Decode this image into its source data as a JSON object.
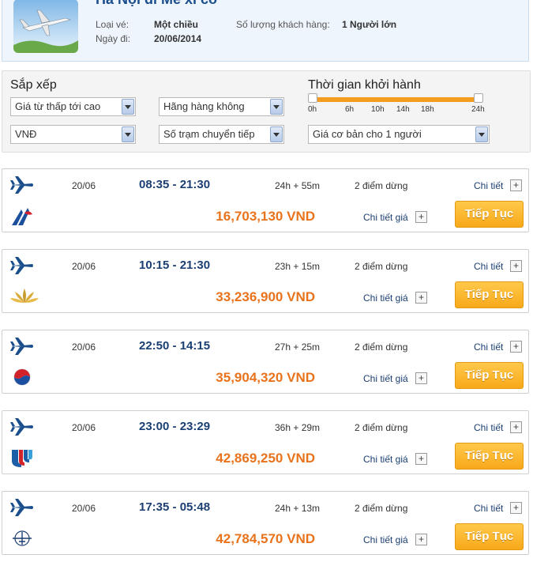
{
  "header": {
    "route_title": "Hà Nội đi Mê xi cô",
    "ticket_type_label": "Loại vé:",
    "ticket_type_value": "Một chiều",
    "passengers_label": "Số lượng khách hàng:",
    "passengers_value": "1 Người lớn",
    "date_label": "Ngày đi:",
    "date_value": "20/06/2014"
  },
  "filters": {
    "sort_title": "Sắp xếp",
    "sort_select": "Giá từ thấp tới cao",
    "airline_select": "Hãng hàng không",
    "currency_select": "VNĐ",
    "stops_select": "Số trạm chuyển tiếp",
    "departure_time_title": "Thời gian khởi hành",
    "price_basis_select": "Giá cơ bản cho 1 người",
    "time_ticks": [
      "0h",
      "6h",
      "10h",
      "14h",
      "18h",
      "24h"
    ]
  },
  "flights": [
    {
      "date": "20/06",
      "time": "08:35 - 21:30",
      "duration": "24h + 55m",
      "stops": "2 điểm dừng",
      "detail": "Chi tiết",
      "price": "16,703,130 VND",
      "price_detail": "Chi tiết giá",
      "continue": "Tiếp Tục",
      "airline_icon": "china-southern-logo-icon"
    },
    {
      "date": "20/06",
      "time": "10:15 - 21:30",
      "duration": "23h + 15m",
      "stops": "2 điểm dừng",
      "detail": "Chi tiết",
      "price": "33,236,900 VND",
      "price_detail": "Chi tiết giá",
      "continue": "Tiếp Tục",
      "airline_icon": "vietnam-airlines-lotus-icon"
    },
    {
      "date": "20/06",
      "time": "22:50 - 14:15",
      "duration": "27h + 25m",
      "stops": "2 điểm dừng",
      "detail": "Chi tiết",
      "price": "35,904,320 VND",
      "price_detail": "Chi tiết giá",
      "continue": "Tiếp Tục",
      "airline_icon": "korean-air-logo-icon"
    },
    {
      "date": "20/06",
      "time": "23:00 - 23:29",
      "duration": "36h + 29m",
      "stops": "2 điểm dừng",
      "detail": "Chi tiết",
      "price": "42,869,250 VND",
      "price_detail": "Chi tiết giá",
      "continue": "Tiếp Tục",
      "airline_icon": "united-airlines-logo-icon"
    },
    {
      "date": "20/06",
      "time": "17:35 - 05:48",
      "duration": "24h + 13m",
      "stops": "2 điểm dừng",
      "detail": "Chi tiết",
      "price": "42,784,570 VND",
      "price_detail": "Chi tiết giá",
      "continue": "Tiếp Tục",
      "airline_icon": "air-france-logo-icon"
    }
  ],
  "colors": {
    "accent_orange": "#f39c1f",
    "price_orange": "#e8731c",
    "navy": "#1b3f72"
  }
}
